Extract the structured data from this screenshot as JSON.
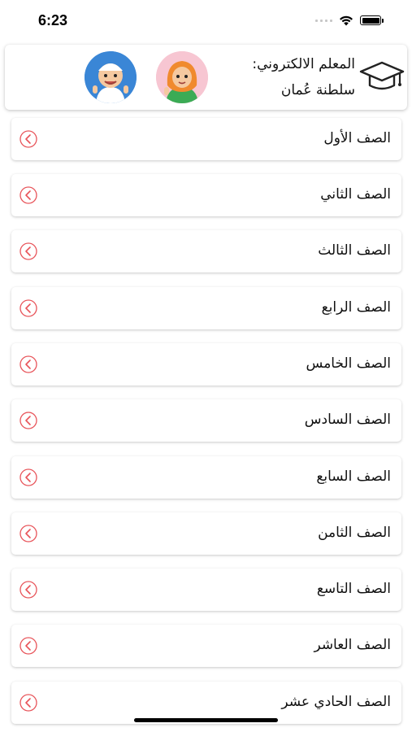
{
  "status_bar": {
    "time": "6:23"
  },
  "header": {
    "title": "المعلم الالكتروني:",
    "subtitle": "سلطنة عُمان",
    "icon": "graduation-cap-icon"
  },
  "grades": [
    {
      "label": "الصف الأول"
    },
    {
      "label": "الصف الثاني"
    },
    {
      "label": "الصف الثالث"
    },
    {
      "label": "الصف الرابع"
    },
    {
      "label": "الصف الخامس"
    },
    {
      "label": "الصف السادس"
    },
    {
      "label": "الصف السابع"
    },
    {
      "label": "الصف الثامن"
    },
    {
      "label": "الصف التاسع"
    },
    {
      "label": "الصف العاشر"
    },
    {
      "label": "الصف الحادي عشر"
    }
  ],
  "colors": {
    "chevron": "#e8545a",
    "text": "#111111",
    "background": "#ffffff"
  }
}
